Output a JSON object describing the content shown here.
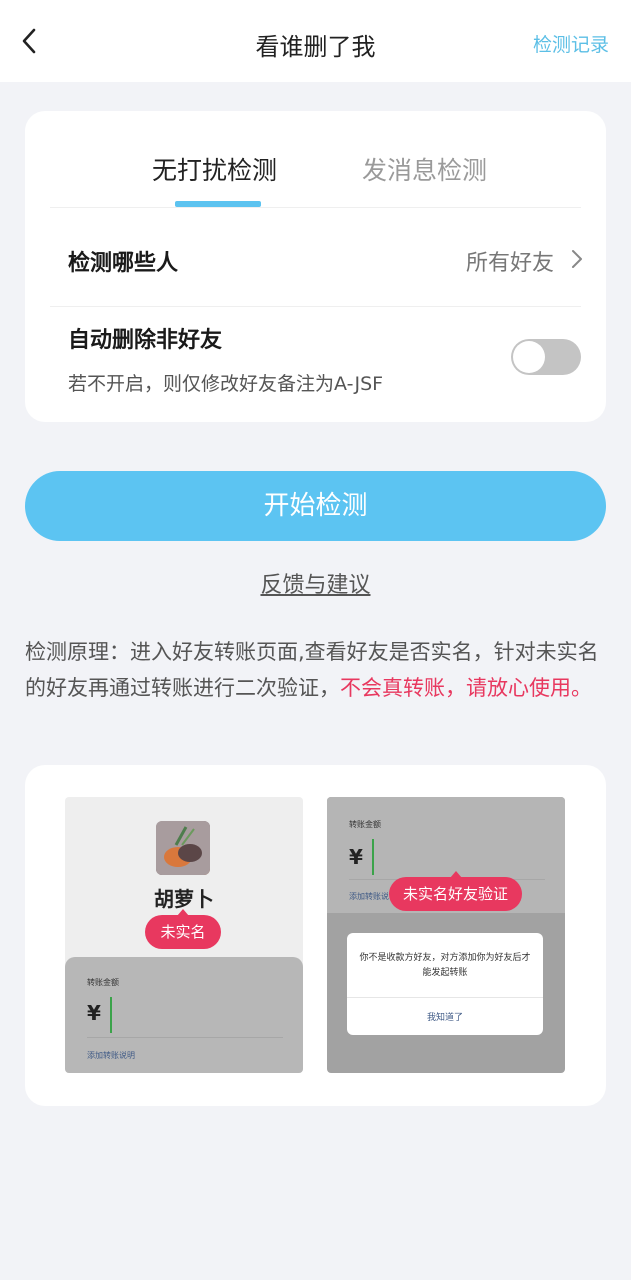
{
  "header": {
    "title": "看谁删了我",
    "history_label": "检测记录",
    "back_icon": "chevron-left-icon"
  },
  "tabs": [
    {
      "label": "无打扰检测",
      "active": true
    },
    {
      "label": "发消息检测",
      "active": false
    }
  ],
  "settings": {
    "who_label": "检测哪些人",
    "who_value": "所有好友",
    "auto_delete_label": "自动删除非好友",
    "auto_delete_note": "若不开启，则仅修改好友备注为A-JSF",
    "auto_delete_enabled": false
  },
  "actions": {
    "start_label": "开始检测",
    "feedback_label": "反馈与建议"
  },
  "principle": {
    "text": "检测原理：进入好友转账页面,查看好友是否实名，针对未实名的好友再通过转账进行二次验证，",
    "warning": "不会真转账，请放心使用。"
  },
  "illustration": {
    "left": {
      "name": "胡萝卜",
      "badge": "未实名",
      "amount_label": "转账金额",
      "currency": "¥",
      "note_link": "添加转账说明"
    },
    "right": {
      "amount_label": "转账金额",
      "currency": "¥",
      "note_link": "添加转账说",
      "badge": "未实名好友验证",
      "dialog_message": "你不是收款方好友，对方添加你为好友后才能发起转账",
      "dialog_button": "我知道了"
    }
  },
  "colors": {
    "accent": "#5cc4f2",
    "warning": "#e8385f",
    "background": "#f2f3f7"
  }
}
